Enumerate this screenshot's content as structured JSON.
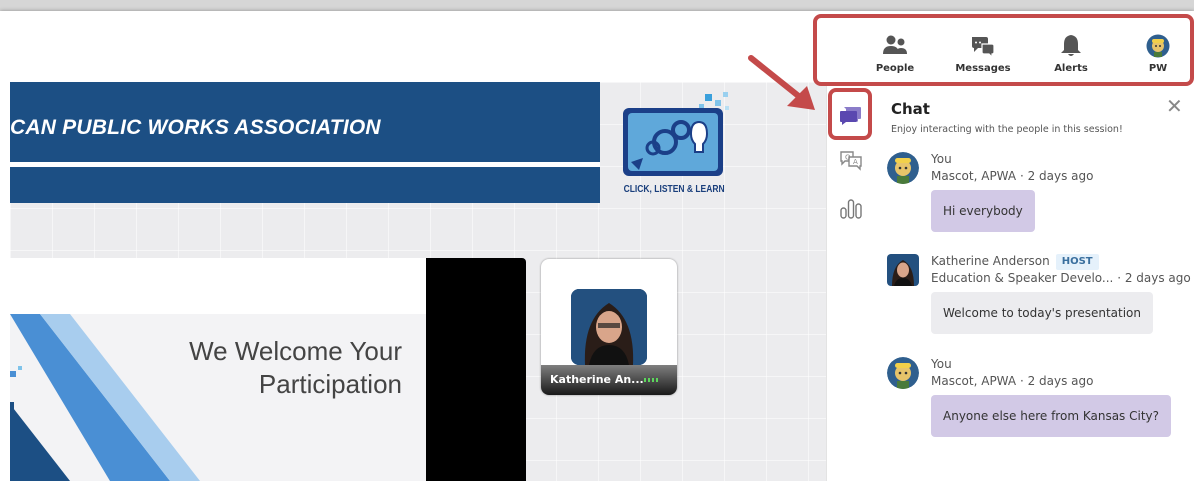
{
  "header": {
    "nav": [
      {
        "label": "People",
        "icon": "people-icon"
      },
      {
        "label": "Messages",
        "icon": "messages-icon"
      },
      {
        "label": "Alerts",
        "icon": "bell-icon"
      },
      {
        "label": "PW",
        "icon": "avatar"
      }
    ]
  },
  "stage": {
    "banner_title": "CAN PUBLIC WORKS ASSOCIATION",
    "logo_label": "CLICK, LISTEN & LEARN",
    "slide_line1": "We Welcome Your",
    "slide_line2": "Participation",
    "video_name": "Katherine An..."
  },
  "sidebar_icons": [
    "chat-icon",
    "q-and-a-icon",
    "polls-icon"
  ],
  "chat": {
    "title": "Chat",
    "subtitle": "Enjoy interacting with the people in this session!",
    "close": "✕",
    "messages": [
      {
        "name": "You",
        "badge": "",
        "org": "Mascot, APWA",
        "time": "· 2 days ago",
        "text": "Hi everybody",
        "mine": true
      },
      {
        "name": "Katherine Anderson",
        "badge": "HOST",
        "org": "Education & Speaker Develo...",
        "time": "· 2 days ago",
        "text": "Welcome to today's presentation",
        "mine": false
      },
      {
        "name": "You",
        "badge": "",
        "org": "Mascot, APWA",
        "time": "· 2 days ago",
        "text": "Anyone else here from Kansas City?",
        "mine": true
      }
    ]
  },
  "colors": {
    "accent": "#6b4fbb",
    "highlight": "#c44a4a",
    "banner": "#1c4f84",
    "bubble_mine": "#d2c9e6"
  }
}
